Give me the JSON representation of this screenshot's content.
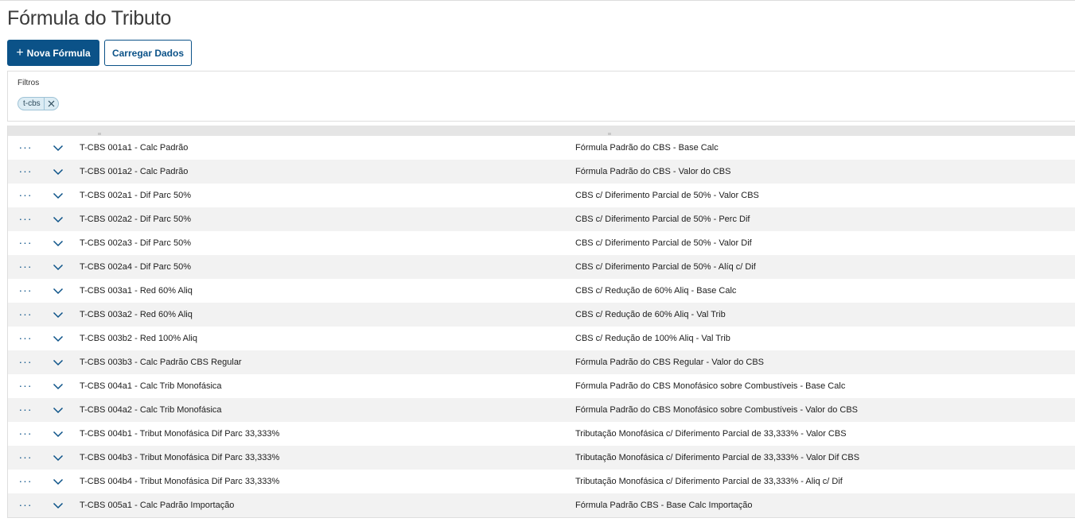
{
  "page": {
    "title": "Fórmula do Tributo"
  },
  "toolbar": {
    "new_label": "Nova Fórmula",
    "load_label": "Carregar Dados"
  },
  "filters": {
    "label": "Filtros",
    "chips": [
      "t-cbs"
    ]
  },
  "colors": {
    "primary": "#0b5288",
    "row_alt": "#f2f2f2",
    "header": "#e5e5e5",
    "chip_bg": "#dcecf4"
  },
  "icons": {
    "row_actions": "more-horizontal-icon",
    "row_expand": "chevron-down-icon",
    "chip_remove": "close-icon",
    "new_button": "plus-icon"
  },
  "table": {
    "rows": [
      {
        "code": "T-CBS 001a1 - Calc Padrão",
        "description": "Fórmula Padrão do CBS - Base Calc"
      },
      {
        "code": "T-CBS 001a2 - Calc Padrão",
        "description": "Fórmula Padrão do CBS - Valor do CBS"
      },
      {
        "code": "T-CBS 002a1 - Dif Parc 50%",
        "description": "CBS c/ Diferimento Parcial de 50% - Valor CBS"
      },
      {
        "code": "T-CBS 002a2 - Dif Parc 50%",
        "description": "CBS c/ Diferimento Parcial de 50% - Perc Dif"
      },
      {
        "code": "T-CBS 002a3 - Dif Parc 50%",
        "description": "CBS c/ Diferimento Parcial de 50% - Valor Dif"
      },
      {
        "code": "T-CBS 002a4 - Dif Parc 50%",
        "description": "CBS c/ Diferimento Parcial de 50% - Alíq c/ Dif"
      },
      {
        "code": "T-CBS 003a1 - Red 60% Aliq",
        "description": "CBS c/ Redução de 60% Aliq - Base Calc"
      },
      {
        "code": "T-CBS 003a2 - Red 60% Aliq",
        "description": "CBS c/ Redução de 60% Aliq - Val Trib"
      },
      {
        "code": "T-CBS 003b2 - Red 100% Aliq",
        "description": "CBS c/ Redução de 100% Aliq - Val Trib"
      },
      {
        "code": "T-CBS 003b3 - Calc Padrão CBS Regular",
        "description": "Fórmula Padrão do CBS Regular - Valor do CBS"
      },
      {
        "code": "T-CBS 004a1 - Calc Trib Monofásica",
        "description": "Fórmula Padrão do CBS Monofásico sobre Combustíveis - Base Calc"
      },
      {
        "code": "T-CBS 004a2 - Calc Trib Monofásica",
        "description": "Fórmula Padrão do CBS Monofásico sobre Combustíveis - Valor do CBS"
      },
      {
        "code": "T-CBS 004b1 - Tribut Monofásica Dif Parc 33,333%",
        "description": "Tributação Monofásica c/ Diferimento Parcial de 33,333% - Valor CBS"
      },
      {
        "code": "T-CBS 004b3 - Tribut Monofásica Dif Parc 33,333%",
        "description": "Tributação Monofásica c/ Diferimento Parcial de 33,333% - Valor Dif CBS"
      },
      {
        "code": "T-CBS 004b4 - Tribut Monofásica Dif Parc 33,333%",
        "description": "Tributação Monofásica c/ Diferimento Parcial de 33,333% - Aliq c/ Dif"
      },
      {
        "code": "T-CBS 005a1 - Calc Padrão Importação",
        "description": "Fórmula Padrão CBS - Base Calc Importação"
      }
    ]
  }
}
